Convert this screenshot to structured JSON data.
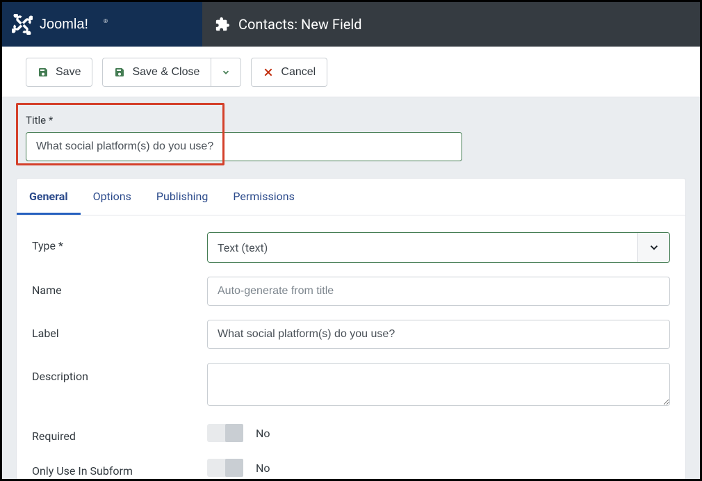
{
  "brand": {
    "name": "Joomla!"
  },
  "header": {
    "title": "Contacts: New Field"
  },
  "toolbar": {
    "save_label": "Save",
    "save_close_label": "Save & Close",
    "cancel_label": "Cancel"
  },
  "title_field": {
    "label": "Title *",
    "value": "What social platform(s) do you use?"
  },
  "tabs": [
    {
      "label": "General",
      "active": true
    },
    {
      "label": "Options",
      "active": false
    },
    {
      "label": "Publishing",
      "active": false
    },
    {
      "label": "Permissions",
      "active": false
    }
  ],
  "form": {
    "type": {
      "label": "Type *",
      "value": "Text (text)"
    },
    "name": {
      "label": "Name",
      "value": "",
      "placeholder": "Auto-generate from title"
    },
    "label_field": {
      "label": "Label",
      "value": "What social platform(s) do you use?"
    },
    "description": {
      "label": "Description",
      "value": ""
    },
    "required": {
      "label": "Required",
      "state_label": "No"
    },
    "only_subform": {
      "label": "Only Use In Subform",
      "state_label": "No"
    }
  }
}
